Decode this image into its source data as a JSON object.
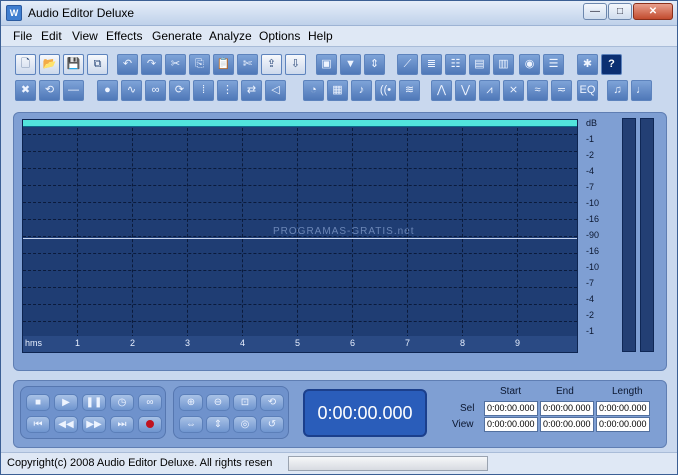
{
  "window": {
    "title": "Audio Editor Deluxe",
    "app_icon": "W",
    "min": "—",
    "max": "□",
    "close": "✕"
  },
  "menu": [
    "File",
    "Edit",
    "View",
    "Effects",
    "Generate",
    "Analyze",
    "Options",
    "Help"
  ],
  "toolbar1": [
    {
      "name": "new-file-icon",
      "glyph": "🗋"
    },
    {
      "name": "open-folder-icon",
      "glyph": "📂"
    },
    {
      "name": "save-icon",
      "glyph": "💾"
    },
    {
      "name": "save-all-icon",
      "glyph": "⧉"
    },
    {
      "name": "undo-icon",
      "glyph": "↶"
    },
    {
      "name": "redo-icon",
      "glyph": "↷"
    },
    {
      "name": "cut-icon",
      "glyph": "✂"
    },
    {
      "name": "copy-icon",
      "glyph": "⎘"
    },
    {
      "name": "paste-icon",
      "glyph": "📋"
    },
    {
      "name": "scissors-icon",
      "glyph": "✄"
    },
    {
      "name": "export-icon",
      "glyph": "⇪"
    },
    {
      "name": "import-icon",
      "glyph": "⇩"
    },
    {
      "name": "crop-icon",
      "glyph": "▣"
    },
    {
      "name": "down-arrow-icon",
      "glyph": "▼"
    },
    {
      "name": "marker-icon",
      "glyph": "⇕"
    },
    {
      "name": "line-icon",
      "glyph": "⟋"
    },
    {
      "name": "equalizer-icon",
      "glyph": "≣"
    },
    {
      "name": "mixer-icon",
      "glyph": "☷"
    },
    {
      "name": "filter-icon",
      "glyph": "▤"
    },
    {
      "name": "spectrum-icon",
      "glyph": "▥"
    },
    {
      "name": "cd-icon",
      "glyph": "◉"
    },
    {
      "name": "record-device-icon",
      "glyph": "☰"
    },
    {
      "name": "settings-icon",
      "glyph": "✱"
    },
    {
      "name": "help-icon",
      "glyph": "?"
    }
  ],
  "toolbar2": [
    {
      "name": "delete-icon",
      "glyph": "✖"
    },
    {
      "name": "undo-selection-icon",
      "glyph": "⟲"
    },
    {
      "name": "silence-icon",
      "glyph": "—"
    },
    {
      "name": "select-point-icon",
      "glyph": "●"
    },
    {
      "name": "waveform-icon",
      "glyph": "∿"
    },
    {
      "name": "loop-icon",
      "glyph": "∞"
    },
    {
      "name": "repeat-icon",
      "glyph": "⟳"
    },
    {
      "name": "split-icon",
      "glyph": "⁞"
    },
    {
      "name": "join-icon",
      "glyph": "⋮"
    },
    {
      "name": "shuffle-icon",
      "glyph": "⇄"
    },
    {
      "name": "speaker-icon",
      "glyph": "◁"
    },
    {
      "name": "timer-icon",
      "glyph": "◔"
    },
    {
      "name": "frame-icon",
      "glyph": "▦"
    },
    {
      "name": "speakers-icon",
      "glyph": "♪"
    },
    {
      "name": "echo-icon",
      "glyph": "((•"
    },
    {
      "name": "chorus-icon",
      "glyph": "≋"
    },
    {
      "name": "fade-in-icon",
      "glyph": "⋀"
    },
    {
      "name": "fade-out-icon",
      "glyph": "⋁"
    },
    {
      "name": "envelope-icon",
      "glyph": "⩘"
    },
    {
      "name": "reverse-icon",
      "glyph": "⨯"
    },
    {
      "name": "stretch-icon",
      "glyph": "≈"
    },
    {
      "name": "normalize-icon",
      "glyph": "≂"
    },
    {
      "name": "eq-icon",
      "glyph": "EQ"
    },
    {
      "name": "note-icon",
      "glyph": "♫"
    },
    {
      "name": "pitch-down-icon",
      "glyph": "♩"
    }
  ],
  "db_scale": [
    "dB",
    "-1",
    "-2",
    "-4",
    "-7",
    "-10",
    "-16",
    "-90",
    "-16",
    "-10",
    "-7",
    "-4",
    "-2",
    "-1"
  ],
  "time_ruler": {
    "unit": "hms",
    "ticks": [
      "1",
      "2",
      "3",
      "4",
      "5",
      "6",
      "7",
      "8",
      "9"
    ]
  },
  "watermark": "PROGRAMAS-GRATIS.net",
  "transport": {
    "left": [
      {
        "name": "stop-icon",
        "glyph": "■"
      },
      {
        "name": "play-icon",
        "glyph": "▶"
      },
      {
        "name": "pause-icon",
        "glyph": "❚❚"
      },
      {
        "name": "play-selection-icon",
        "glyph": "◷"
      },
      {
        "name": "loop-play-icon",
        "glyph": "∞"
      },
      {
        "name": "go-start-icon",
        "glyph": "⏮"
      },
      {
        "name": "rewind-icon",
        "glyph": "◀◀"
      },
      {
        "name": "fast-forward-icon",
        "glyph": "▶▶"
      },
      {
        "name": "go-end-icon",
        "glyph": "⏭"
      },
      {
        "name": "record-icon",
        "glyph": ""
      }
    ],
    "right": [
      {
        "name": "zoom-in-icon",
        "glyph": "⊕"
      },
      {
        "name": "zoom-out-icon",
        "glyph": "⊖"
      },
      {
        "name": "zoom-selection-icon",
        "glyph": "⊡"
      },
      {
        "name": "zoom-full-icon",
        "glyph": "⟲"
      },
      {
        "name": "zoom-horizontal-icon",
        "glyph": "⇔"
      },
      {
        "name": "zoom-vertical-icon",
        "glyph": "⇕"
      },
      {
        "name": "zoom-fit-icon",
        "glyph": "◎"
      },
      {
        "name": "zoom-reset-icon",
        "glyph": "↺"
      }
    ],
    "time": "0:00:00.000"
  },
  "selection_info": {
    "headers": [
      "Start",
      "End",
      "Length"
    ],
    "rows": [
      {
        "label": "Sel",
        "values": [
          "0:00:00.000",
          "0:00:00.000",
          "0:00:00.000"
        ]
      },
      {
        "label": "View",
        "values": [
          "0:00:00.000",
          "0:00:00.000",
          "0:00:00.000"
        ]
      }
    ]
  },
  "status": {
    "text": "Copyright(c) 2008 Audio Editor Deluxe. All rights resen"
  }
}
